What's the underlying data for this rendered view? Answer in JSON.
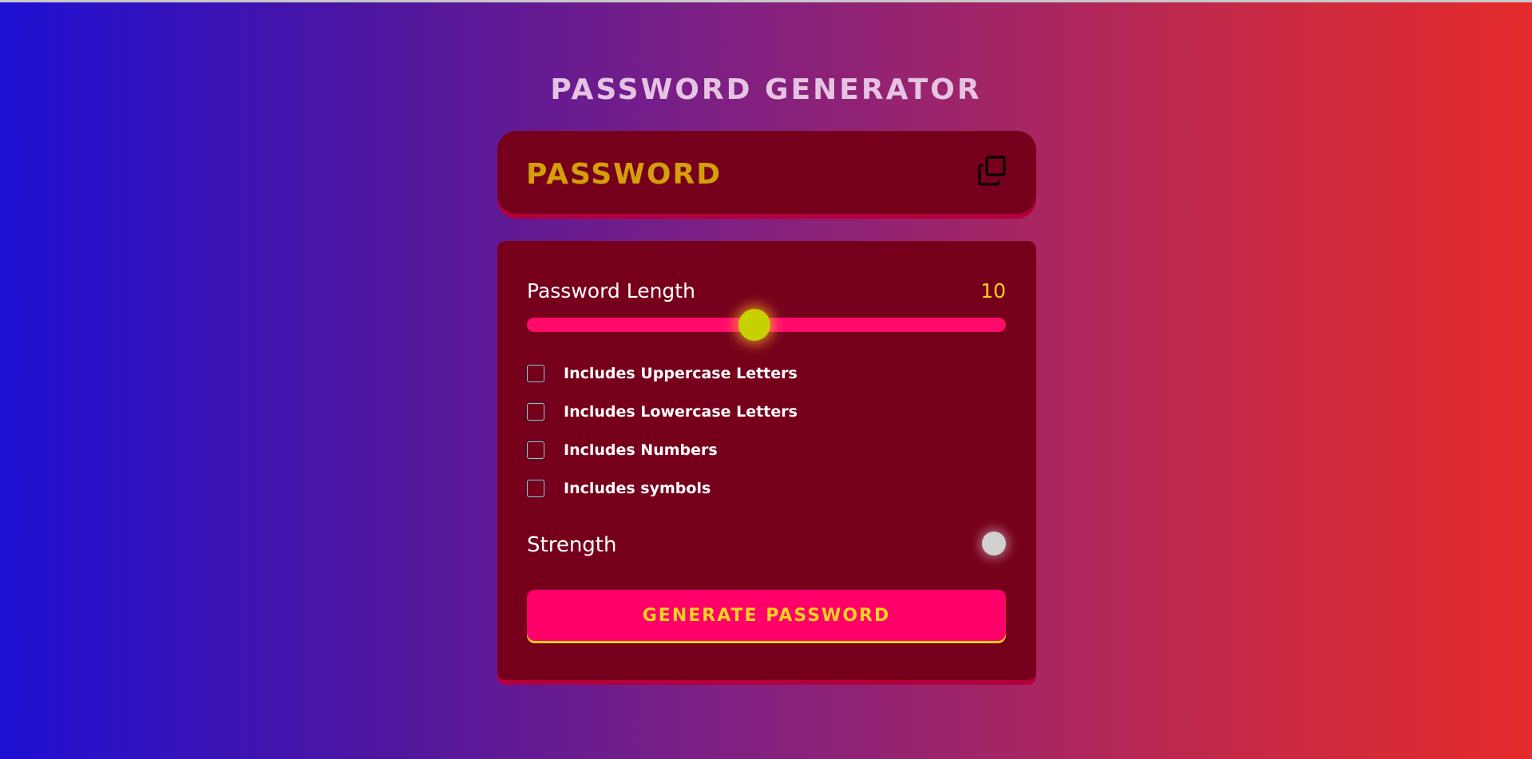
{
  "app": {
    "title": "PASSWORD GENERATOR"
  },
  "display": {
    "password": "PASSWORD",
    "copy_icon": "copy-icon"
  },
  "length": {
    "label": "Password Length",
    "value": "10",
    "slider_fraction": 0.475
  },
  "options": [
    {
      "label": "Includes Uppercase Letters",
      "checked": false
    },
    {
      "label": "Includes Lowercase Letters",
      "checked": false
    },
    {
      "label": "Includes Numbers",
      "checked": false
    },
    {
      "label": "Includes symbols",
      "checked": false
    }
  ],
  "strength": {
    "label": "Strength"
  },
  "actions": {
    "generate_label": "GENERATE PASSWORD"
  },
  "colors": {
    "panel": "#76001c",
    "accent": "#ff006b",
    "highlight": "#f6d51c",
    "password_text": "#d49f09",
    "checkbox_border": "#6fd1d6"
  }
}
